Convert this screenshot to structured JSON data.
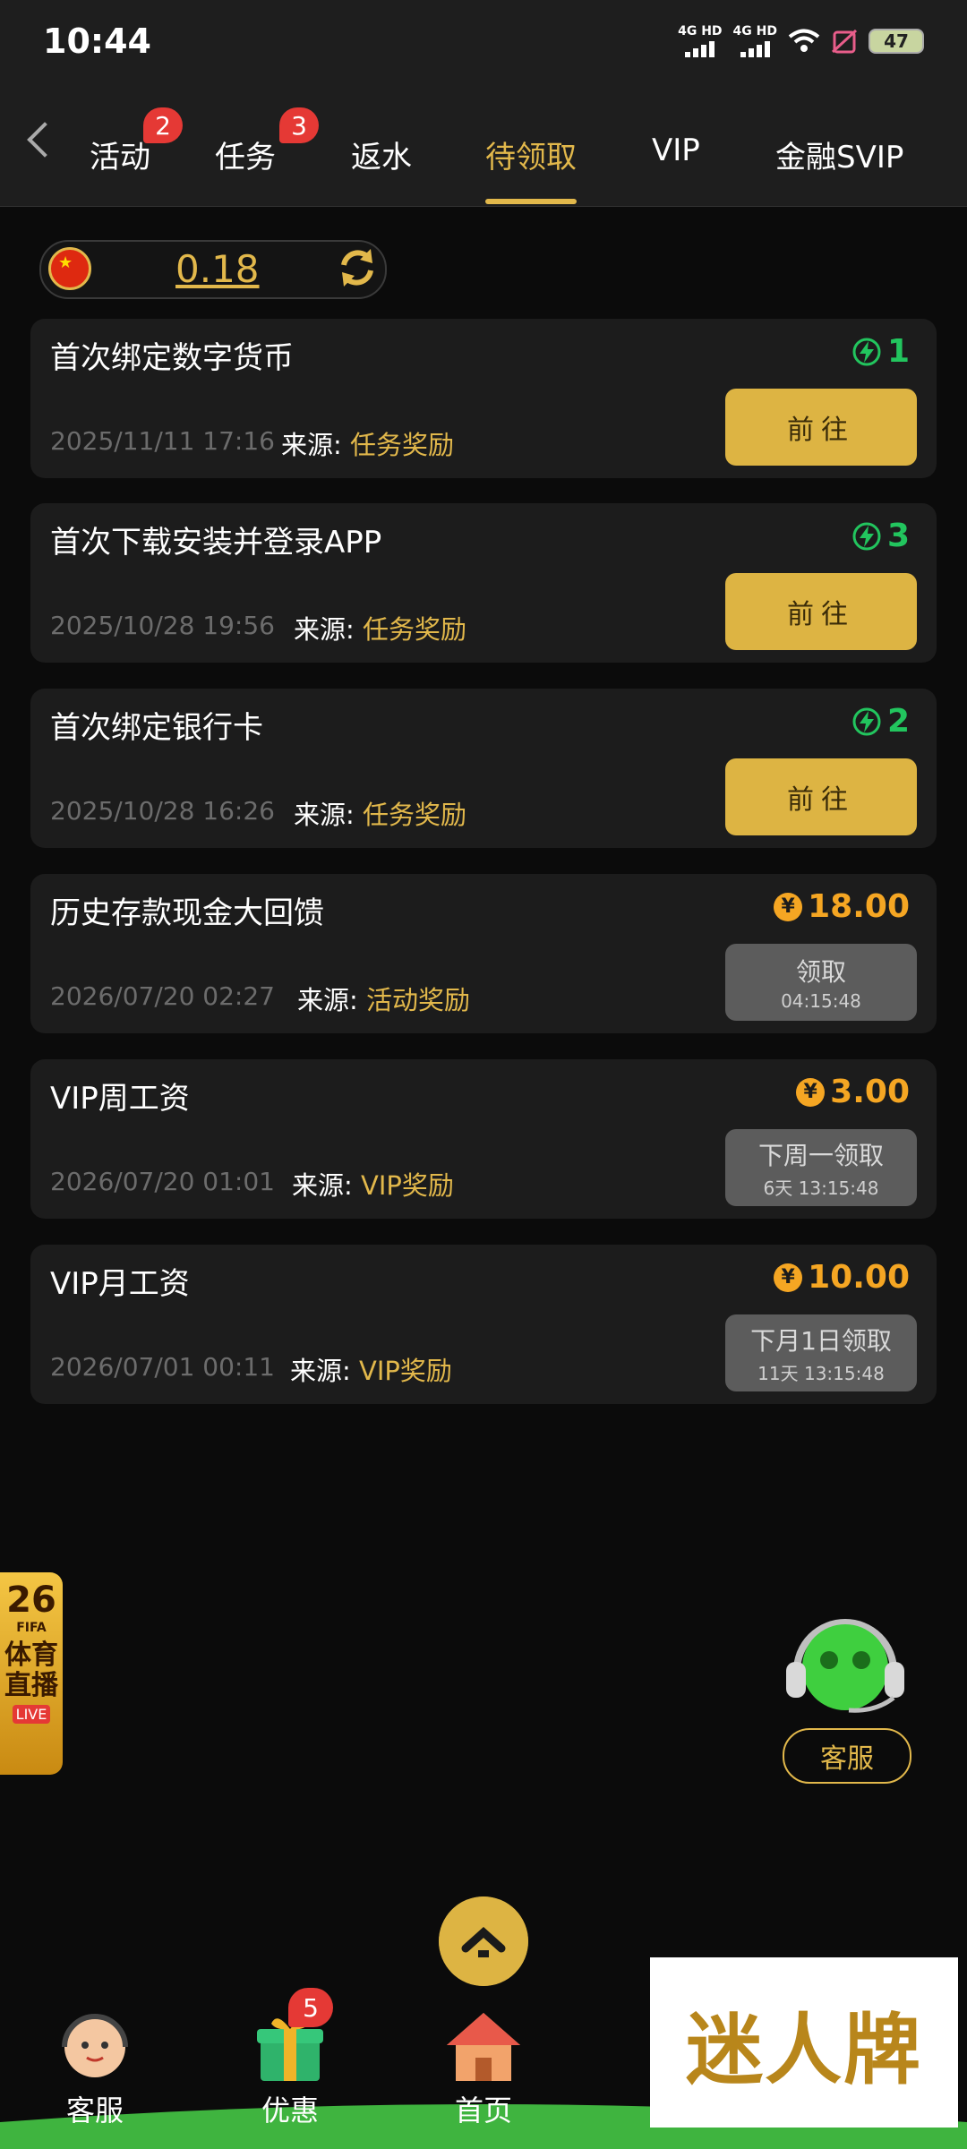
{
  "status_bar": {
    "time": "10:44",
    "signal1": "4G HD",
    "signal2": "4G HD",
    "battery": "47"
  },
  "tabs": [
    {
      "label": "活动",
      "badge": "2"
    },
    {
      "label": "任务",
      "badge": "3"
    },
    {
      "label": "返水"
    },
    {
      "label": "待领取",
      "active": true
    },
    {
      "label": "VIP"
    },
    {
      "label": "金融SVIP"
    }
  ],
  "balance": {
    "value": "0.18"
  },
  "colors": {
    "accent": "#e2b84b",
    "green": "#22c55e",
    "amount_gold": "#f5a623"
  },
  "rewards": [
    {
      "title": "首次绑定数字货币",
      "date": "2025/11/11 17:16",
      "source_label": "来源:",
      "source": "任务奖励",
      "amount": "1",
      "amount_icon": "lightning-icon",
      "button": "前往"
    },
    {
      "title": "首次下载安装并登录APP",
      "date": "2025/10/28 19:56",
      "source_label": "来源:",
      "source": "任务奖励",
      "amount": "3",
      "amount_icon": "lightning-icon",
      "button": "前往"
    },
    {
      "title": "首次绑定银行卡",
      "date": "2025/10/28 16:26",
      "source_label": "来源:",
      "source": "任务奖励",
      "amount": "2",
      "amount_icon": "lightning-icon",
      "button": "前往"
    },
    {
      "title": "历史存款现金大回馈",
      "date": "2026/07/20 02:27",
      "source_label": "来源:",
      "source": "活动奖励",
      "amount": "18.00",
      "amount_icon": "yen-coin-icon",
      "button": "领取",
      "button_sub": "04:15:48"
    },
    {
      "title": "VIP周工资",
      "date": "2026/07/20 01:01",
      "source_label": "来源:",
      "source": "VIP奖励",
      "amount": "3.00",
      "amount_icon": "yen-coin-icon",
      "button": "下周一领取",
      "button_sub": "6天 13:15:48"
    },
    {
      "title": "VIP月工资",
      "date": "2026/07/01 00:11",
      "source_label": "来源:",
      "source": "VIP奖励",
      "amount": "10.00",
      "amount_icon": "yen-coin-icon",
      "button": "下月1日领取",
      "button_sub": "11天 13:15:48"
    }
  ],
  "coin_symbol": "¥",
  "side_banner": {
    "number": "26",
    "fifa": "FIFA",
    "text": "体育直播",
    "live": "LIVE"
  },
  "customer_service": {
    "label": "客服"
  },
  "bottom_nav": [
    {
      "label": "客服",
      "icon": "support-face-icon"
    },
    {
      "label": "优惠",
      "icon": "gift-icon",
      "badge": "5"
    },
    {
      "label": "首页",
      "icon": "home-icon"
    }
  ],
  "watermark": "迷人牌"
}
